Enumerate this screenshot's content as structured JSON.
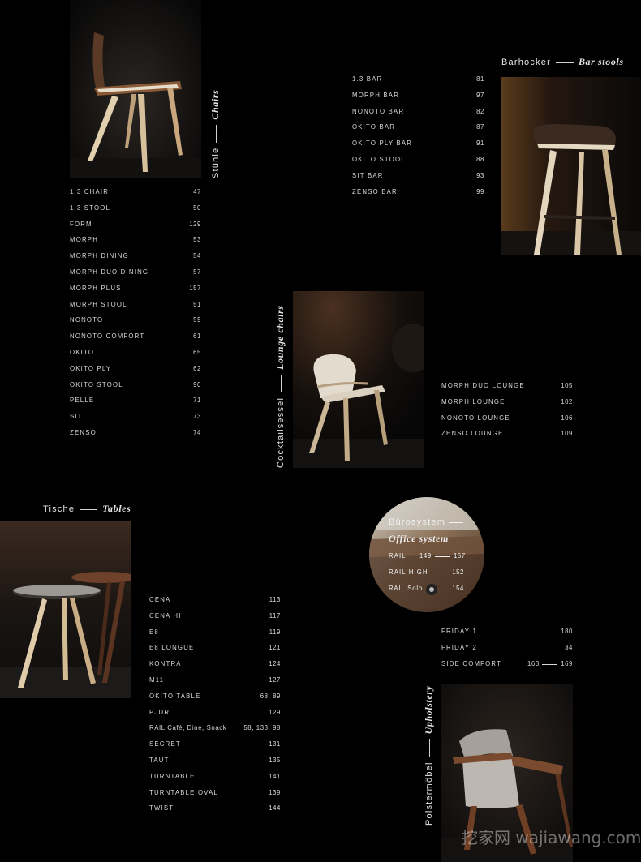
{
  "chairs": {
    "heading_de": "Stühle",
    "heading_en": "Chairs",
    "items": [
      {
        "name": "1.3 CHAIR",
        "page": "47"
      },
      {
        "name": "1.3 STOOL",
        "page": "50"
      },
      {
        "name": "FORM",
        "page": "129"
      },
      {
        "name": "MORPH",
        "page": "53"
      },
      {
        "name": "MORPH DINING",
        "page": "54"
      },
      {
        "name": "MORPH DUO DINING",
        "page": "57"
      },
      {
        "name": "MORPH PLUS",
        "page": "157"
      },
      {
        "name": "MORPH STOOL",
        "page": "51"
      },
      {
        "name": "NONOTO",
        "page": "59"
      },
      {
        "name": "NONOTO COMFORT",
        "page": "61"
      },
      {
        "name": "OKITO",
        "page": "65"
      },
      {
        "name": "OKITO PLY",
        "page": "62"
      },
      {
        "name": "OKITO STOOL",
        "page": "90"
      },
      {
        "name": "PELLE",
        "page": "71"
      },
      {
        "name": "SIT",
        "page": "73"
      },
      {
        "name": "ZENSO",
        "page": "74"
      }
    ]
  },
  "bar_stools": {
    "heading_de": "Barhocker",
    "heading_en": "Bar stools",
    "items": [
      {
        "name": "1.3 BAR",
        "page": "81"
      },
      {
        "name": "MORPH BAR",
        "page": "97"
      },
      {
        "name": "NONOTO BAR",
        "page": "82"
      },
      {
        "name": "OKITO BAR",
        "page": "87"
      },
      {
        "name": "OKITO PLY BAR",
        "page": "91"
      },
      {
        "name": "OKITO STOOL",
        "page": "88"
      },
      {
        "name": "SIT BAR",
        "page": "93"
      },
      {
        "name": "ZENSO BAR",
        "page": "99"
      }
    ]
  },
  "lounge_chairs": {
    "heading_de": "Cocktailsessel",
    "heading_en": "Lounge chairs",
    "items": [
      {
        "name": "MORPH DUO LOUNGE",
        "page": "105"
      },
      {
        "name": "MORPH LOUNGE",
        "page": "102"
      },
      {
        "name": "NONOTO LOUNGE",
        "page": "106"
      },
      {
        "name": "ZENSO LOUNGE",
        "page": "109"
      }
    ]
  },
  "tables": {
    "heading_de": "Tische",
    "heading_en": "Tables",
    "items": [
      {
        "name": "CENA",
        "page": "113"
      },
      {
        "name": "CENA HI",
        "page": "117"
      },
      {
        "name": "E8",
        "page": "119"
      },
      {
        "name": "E8 LONGUE",
        "page": "121"
      },
      {
        "name": "KONTRA",
        "page": "124"
      },
      {
        "name": "M11",
        "page": "127"
      },
      {
        "name": "OKITO TABLE",
        "page": "68, 89"
      },
      {
        "name": "PJUR",
        "page": "129"
      },
      {
        "name": "RAIL Café, Dine, Snack",
        "page": "58, 133, 98"
      },
      {
        "name": "SECRET",
        "page": "131"
      },
      {
        "name": "TAUT",
        "page": "135"
      },
      {
        "name": "TURNTABLE",
        "page": "141"
      },
      {
        "name": "TURNTABLE OVAL",
        "page": "139"
      },
      {
        "name": "TWIST",
        "page": "144"
      }
    ]
  },
  "office": {
    "heading_de": "Bürosystem",
    "heading_en": "Office system",
    "items": [
      {
        "name": "RAIL",
        "page_from": "149",
        "page_to": "157"
      },
      {
        "name": "RAIL HIGH",
        "page": "152"
      },
      {
        "name": "RAIL Solo",
        "page": "154"
      }
    ]
  },
  "upholstery": {
    "heading_de": "Polstermöbel",
    "heading_en": "Upholstery",
    "items": [
      {
        "name": "FRIDAY 1",
        "page": "180"
      },
      {
        "name": "FRIDAY 2",
        "page": "34"
      },
      {
        "name": "SIDE COMFORT",
        "page_from": "163",
        "page_to": "169"
      }
    ]
  },
  "watermark": "挖家网 wajiawang.com",
  "colors": {
    "background": "#000000",
    "text": "#d8d8d8",
    "wood_light": "#d9c3a0",
    "wood_dark": "#7a4a2e"
  }
}
